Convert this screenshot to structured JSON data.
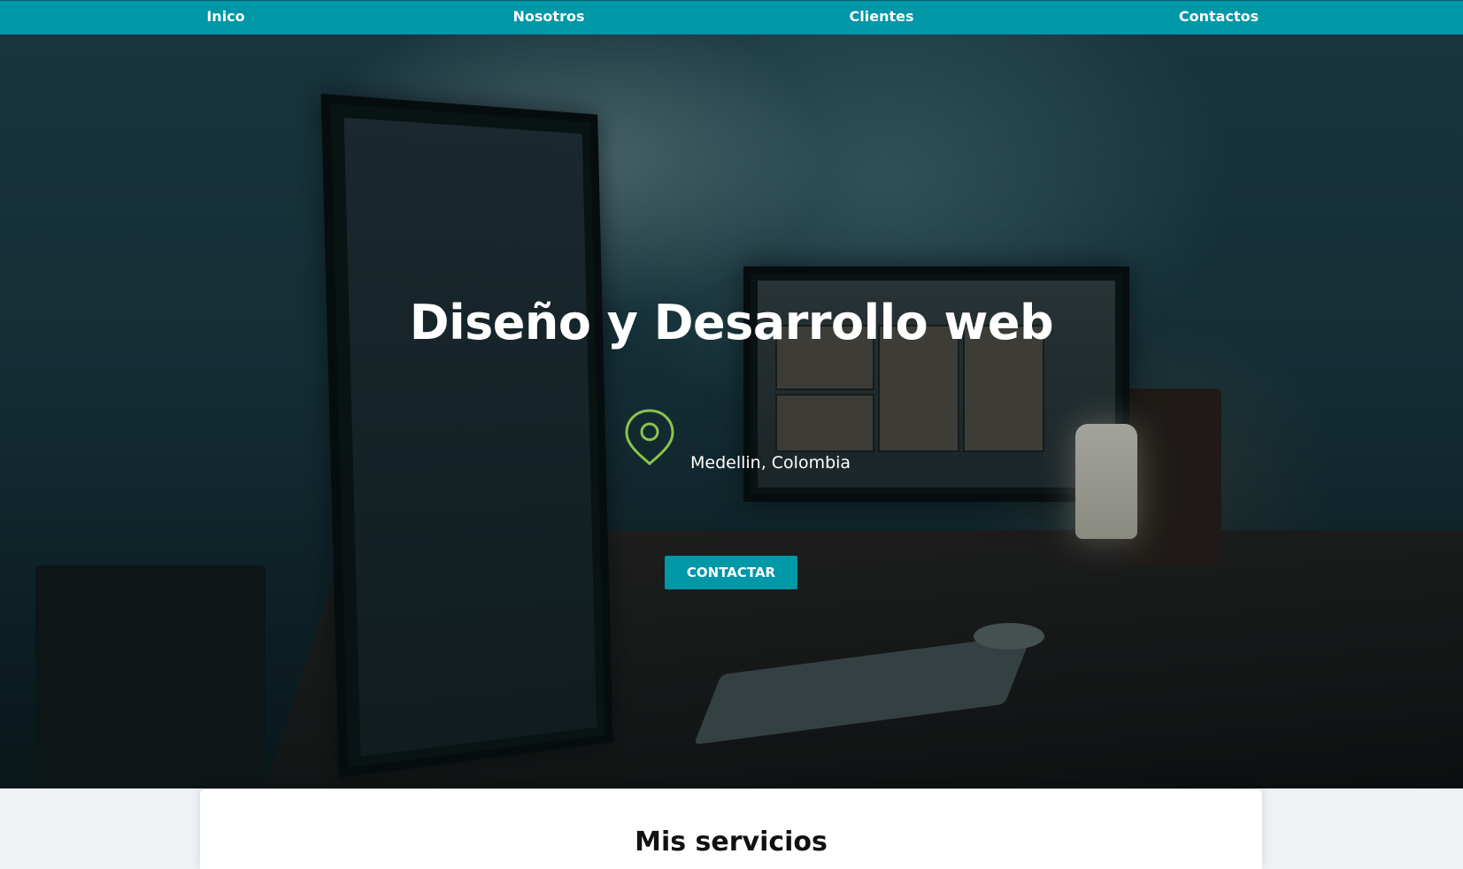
{
  "nav": {
    "items": [
      {
        "label": "Inico"
      },
      {
        "label": "Nosotros"
      },
      {
        "label": "Clientes"
      },
      {
        "label": "Contactos"
      }
    ]
  },
  "hero": {
    "title": "Diseño y Desarrollo web",
    "location": "Medellin, Colombia",
    "cta_label": "CONTACTAR"
  },
  "services": {
    "heading": "Mis servicios"
  },
  "colors": {
    "accent": "#0097a7",
    "pin": "#8bc34a",
    "text_light": "#ffffff"
  },
  "icons": {
    "location": "map-pin-icon"
  }
}
